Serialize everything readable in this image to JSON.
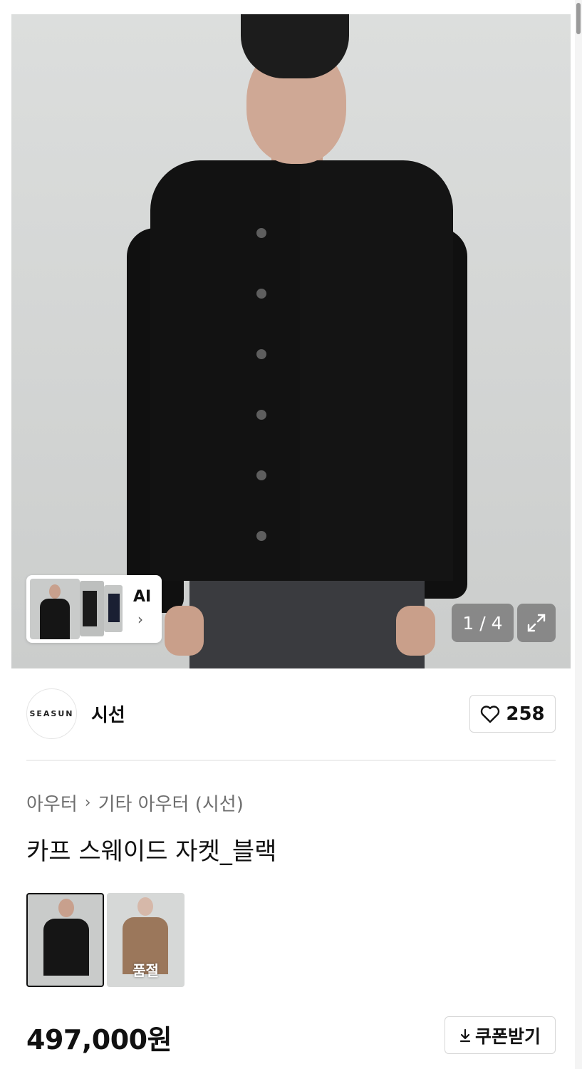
{
  "gallery": {
    "counter": "1 / 4",
    "ai_label": "AI",
    "ai_chevron": "›"
  },
  "brand": {
    "logo_text": "SEASUN",
    "name": "시선",
    "like_count": "258"
  },
  "breadcrumb": {
    "items": [
      "아우터",
      "기타 아우터 (시선)"
    ],
    "separator": "›"
  },
  "product": {
    "title": "카프 스웨이드 자켓_블랙",
    "price": "497,000원"
  },
  "color_options": [
    {
      "color": "#151515",
      "selected": true,
      "label": ""
    },
    {
      "color": "#7a4a25",
      "selected": false,
      "label": "품절"
    }
  ],
  "coupon": {
    "label": "쿠폰받기",
    "icon": "download-icon"
  },
  "colors": {
    "text": "#111111",
    "muted": "#6e6e6e",
    "border": "#d6d6d6"
  }
}
